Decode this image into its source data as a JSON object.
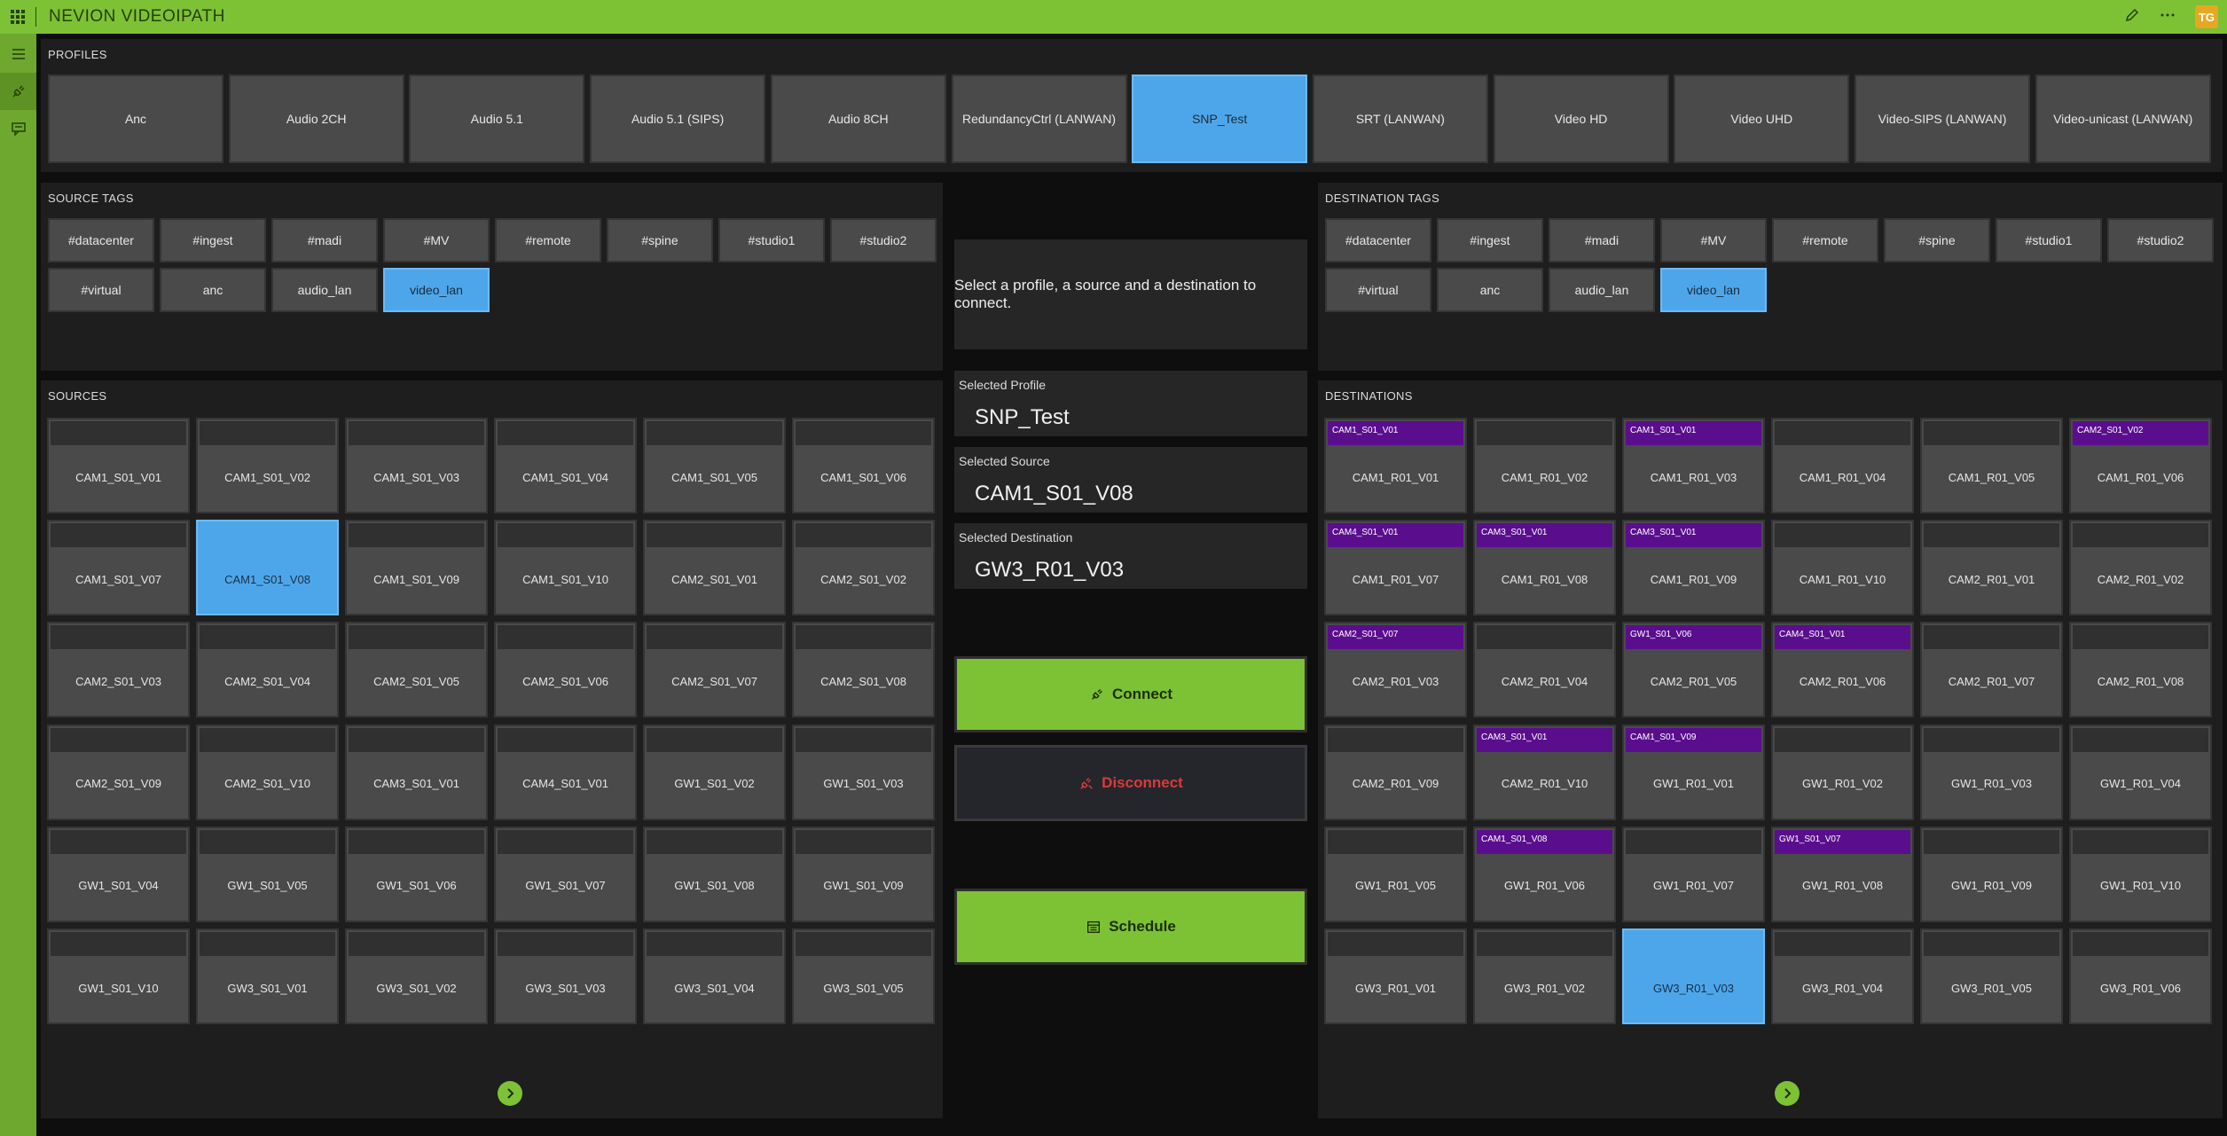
{
  "app": {
    "title": "NEVION VIDEOIPATH",
    "user_initials": "TG"
  },
  "profiles": {
    "title": "PROFILES",
    "items": [
      "Anc",
      "Audio 2CH",
      "Audio 5.1",
      "Audio 5.1 (SIPS)",
      "Audio 8CH",
      "RedundancyCtrl (LANWAN)",
      "SNP_Test",
      "SRT (LANWAN)",
      "Video HD",
      "Video UHD",
      "Video-SIPS (LANWAN)",
      "Video-unicast (LANWAN)"
    ],
    "selected": "SNP_Test"
  },
  "source_tags": {
    "title": "SOURCE TAGS",
    "items": [
      "#datacenter",
      "#ingest",
      "#madi",
      "#MV",
      "#remote",
      "#spine",
      "#studio1",
      "#studio2",
      "#virtual",
      "anc",
      "audio_lan",
      "video_lan"
    ],
    "selected": "video_lan"
  },
  "destination_tags": {
    "title": "DESTINATION TAGS",
    "items": [
      "#datacenter",
      "#ingest",
      "#madi",
      "#MV",
      "#remote",
      "#spine",
      "#studio1",
      "#studio2",
      "#virtual",
      "anc",
      "audio_lan",
      "video_lan"
    ],
    "selected": "video_lan"
  },
  "center": {
    "message": "Select a profile, a source and a destination to connect.",
    "selected_profile_label": "Selected Profile",
    "selected_profile": "SNP_Test",
    "selected_source_label": "Selected Source",
    "selected_source": "CAM1_S01_V08",
    "selected_destination_label": "Selected Destination",
    "selected_destination": "GW3_R01_V03",
    "connect_label": "Connect",
    "disconnect_label": "Disconnect",
    "schedule_label": "Schedule"
  },
  "sources": {
    "title": "SOURCES",
    "items": [
      {
        "label": "CAM1_S01_V01",
        "tag": ""
      },
      {
        "label": "CAM1_S01_V02",
        "tag": ""
      },
      {
        "label": "CAM1_S01_V03",
        "tag": ""
      },
      {
        "label": "CAM1_S01_V04",
        "tag": ""
      },
      {
        "label": "CAM1_S01_V05",
        "tag": ""
      },
      {
        "label": "CAM1_S01_V06",
        "tag": ""
      },
      {
        "label": "CAM1_S01_V07",
        "tag": ""
      },
      {
        "label": "CAM1_S01_V08",
        "tag": ""
      },
      {
        "label": "CAM1_S01_V09",
        "tag": ""
      },
      {
        "label": "CAM1_S01_V10",
        "tag": ""
      },
      {
        "label": "CAM2_S01_V01",
        "tag": ""
      },
      {
        "label": "CAM2_S01_V02",
        "tag": ""
      },
      {
        "label": "CAM2_S01_V03",
        "tag": ""
      },
      {
        "label": "CAM2_S01_V04",
        "tag": ""
      },
      {
        "label": "CAM2_S01_V05",
        "tag": ""
      },
      {
        "label": "CAM2_S01_V06",
        "tag": ""
      },
      {
        "label": "CAM2_S01_V07",
        "tag": ""
      },
      {
        "label": "CAM2_S01_V08",
        "tag": ""
      },
      {
        "label": "CAM2_S01_V09",
        "tag": ""
      },
      {
        "label": "CAM2_S01_V10",
        "tag": ""
      },
      {
        "label": "CAM3_S01_V01",
        "tag": ""
      },
      {
        "label": "CAM4_S01_V01",
        "tag": ""
      },
      {
        "label": "GW1_S01_V02",
        "tag": ""
      },
      {
        "label": "GW1_S01_V03",
        "tag": ""
      },
      {
        "label": "GW1_S01_V04",
        "tag": ""
      },
      {
        "label": "GW1_S01_V05",
        "tag": ""
      },
      {
        "label": "GW1_S01_V06",
        "tag": ""
      },
      {
        "label": "GW1_S01_V07",
        "tag": ""
      },
      {
        "label": "GW1_S01_V08",
        "tag": ""
      },
      {
        "label": "GW1_S01_V09",
        "tag": ""
      },
      {
        "label": "GW1_S01_V10",
        "tag": ""
      },
      {
        "label": "GW3_S01_V01",
        "tag": ""
      },
      {
        "label": "GW3_S01_V02",
        "tag": ""
      },
      {
        "label": "GW3_S01_V03",
        "tag": ""
      },
      {
        "label": "GW3_S01_V04",
        "tag": ""
      },
      {
        "label": "GW3_S01_V05",
        "tag": ""
      }
    ],
    "selected": "CAM1_S01_V08"
  },
  "destinations": {
    "title": "DESTINATIONS",
    "items": [
      {
        "label": "CAM1_R01_V01",
        "tag": "CAM1_S01_V01"
      },
      {
        "label": "CAM1_R01_V02",
        "tag": ""
      },
      {
        "label": "CAM1_R01_V03",
        "tag": "CAM1_S01_V01"
      },
      {
        "label": "CAM1_R01_V04",
        "tag": ""
      },
      {
        "label": "CAM1_R01_V05",
        "tag": ""
      },
      {
        "label": "CAM1_R01_V06",
        "tag": "CAM2_S01_V02"
      },
      {
        "label": "CAM1_R01_V07",
        "tag": "CAM4_S01_V01"
      },
      {
        "label": "CAM1_R01_V08",
        "tag": "CAM3_S01_V01"
      },
      {
        "label": "CAM1_R01_V09",
        "tag": "CAM3_S01_V01"
      },
      {
        "label": "CAM1_R01_V10",
        "tag": ""
      },
      {
        "label": "CAM2_R01_V01",
        "tag": ""
      },
      {
        "label": "CAM2_R01_V02",
        "tag": ""
      },
      {
        "label": "CAM2_R01_V03",
        "tag": "CAM2_S01_V07"
      },
      {
        "label": "CAM2_R01_V04",
        "tag": ""
      },
      {
        "label": "CAM2_R01_V05",
        "tag": "GW1_S01_V06"
      },
      {
        "label": "CAM2_R01_V06",
        "tag": "CAM4_S01_V01"
      },
      {
        "label": "CAM2_R01_V07",
        "tag": ""
      },
      {
        "label": "CAM2_R01_V08",
        "tag": ""
      },
      {
        "label": "CAM2_R01_V09",
        "tag": ""
      },
      {
        "label": "CAM2_R01_V10",
        "tag": "CAM3_S01_V01"
      },
      {
        "label": "GW1_R01_V01",
        "tag": "CAM1_S01_V09"
      },
      {
        "label": "GW1_R01_V02",
        "tag": ""
      },
      {
        "label": "GW1_R01_V03",
        "tag": ""
      },
      {
        "label": "GW1_R01_V04",
        "tag": ""
      },
      {
        "label": "GW1_R01_V05",
        "tag": ""
      },
      {
        "label": "GW1_R01_V06",
        "tag": "CAM1_S01_V08"
      },
      {
        "label": "GW1_R01_V07",
        "tag": ""
      },
      {
        "label": "GW1_R01_V08",
        "tag": "GW1_S01_V07"
      },
      {
        "label": "GW1_R01_V09",
        "tag": ""
      },
      {
        "label": "GW1_R01_V10",
        "tag": ""
      },
      {
        "label": "GW3_R01_V01",
        "tag": ""
      },
      {
        "label": "GW3_R01_V02",
        "tag": ""
      },
      {
        "label": "GW3_R01_V03",
        "tag": ""
      },
      {
        "label": "GW3_R01_V04",
        "tag": ""
      },
      {
        "label": "GW3_R01_V05",
        "tag": ""
      },
      {
        "label": "GW3_R01_V06",
        "tag": ""
      }
    ],
    "selected": "GW3_R01_V03"
  },
  "colors": {
    "accent": "#7dc135",
    "selected": "#4ea6ea",
    "tag_active": "#5a0e8e",
    "disconnect": "#d93a3a"
  },
  "icons": [
    "apps-icon",
    "pencil-icon",
    "more-icon",
    "menu-icon",
    "plug-icon",
    "chat-icon",
    "chevron-right-icon",
    "calendar-icon"
  ]
}
